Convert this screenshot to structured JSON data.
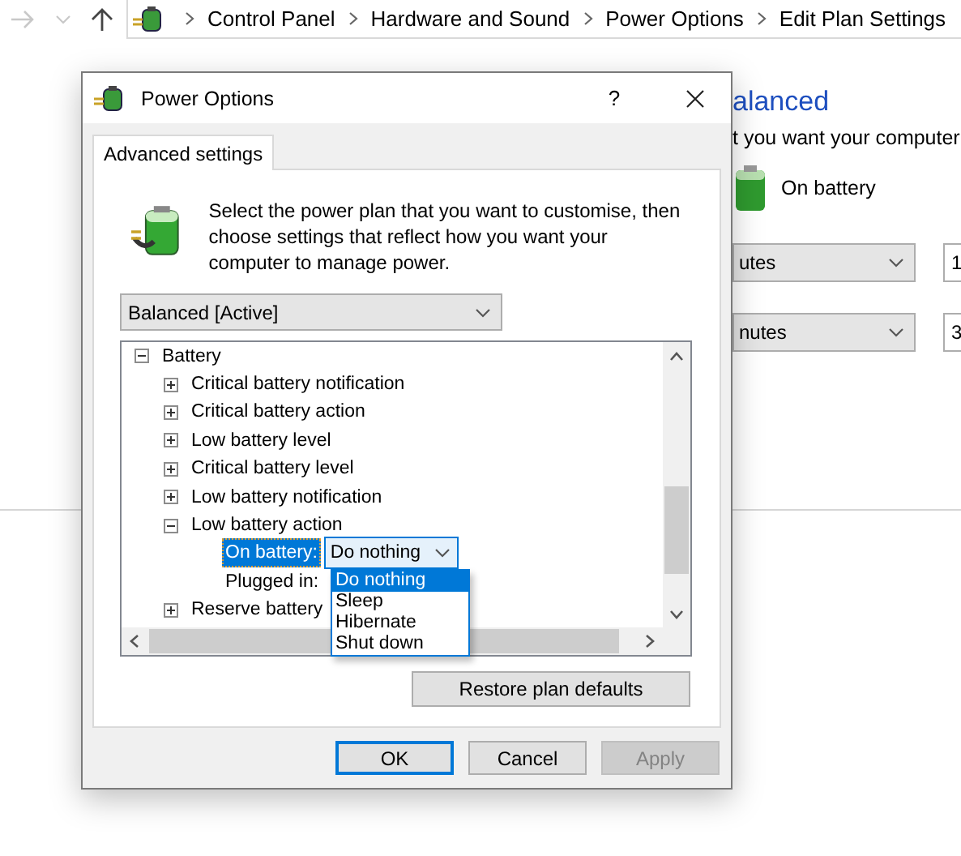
{
  "explorer": {
    "breadcrumb": [
      "Control Panel",
      "Hardware and Sound",
      "Power Options",
      "Edit Plan Settings"
    ],
    "heading": "alanced",
    "subtitle": "t you want your computer",
    "column_label": "On battery",
    "dropdowns": [
      {
        "value": "utes"
      },
      {
        "value": "nutes"
      }
    ],
    "fields": [
      "1",
      "3"
    ]
  },
  "dialog": {
    "title": "Power Options",
    "help": "?",
    "tabs": [
      {
        "label": "Advanced settings",
        "selected": true
      }
    ],
    "description": "Select the power plan that you want to customise, then choose settings that reflect how you want your computer to manage power.",
    "plan": "Balanced [Active]",
    "tree": [
      {
        "kind": "group",
        "label": "Battery",
        "expanded": true,
        "children": [
          {
            "kind": "group",
            "label": "Critical battery notification",
            "expanded": false
          },
          {
            "kind": "group",
            "label": "Critical battery action",
            "expanded": false
          },
          {
            "kind": "group",
            "label": "Low battery level",
            "expanded": false
          },
          {
            "kind": "group",
            "label": "Critical battery level",
            "expanded": false
          },
          {
            "kind": "group",
            "label": "Low battery notification",
            "expanded": false
          },
          {
            "kind": "group",
            "label": "Low battery action",
            "expanded": true,
            "children": [
              {
                "kind": "setting",
                "label": "On battery:",
                "selected": true,
                "value": "Do nothing",
                "open": true
              },
              {
                "kind": "setting",
                "label": "Plugged in:",
                "selected": false
              }
            ]
          },
          {
            "kind": "group",
            "label": "Reserve battery",
            "expanded": false
          }
        ]
      }
    ],
    "popup_options": [
      {
        "label": "Do nothing",
        "selected": true
      },
      {
        "label": "Sleep",
        "selected": false
      },
      {
        "label": "Hibernate",
        "selected": false
      },
      {
        "label": "Shut down",
        "selected": false
      }
    ],
    "restore_button": "Restore plan defaults",
    "buttons": [
      {
        "label": "OK",
        "kind": "default"
      },
      {
        "label": "Cancel",
        "kind": "normal"
      },
      {
        "label": "Apply",
        "kind": "disabled"
      }
    ]
  }
}
